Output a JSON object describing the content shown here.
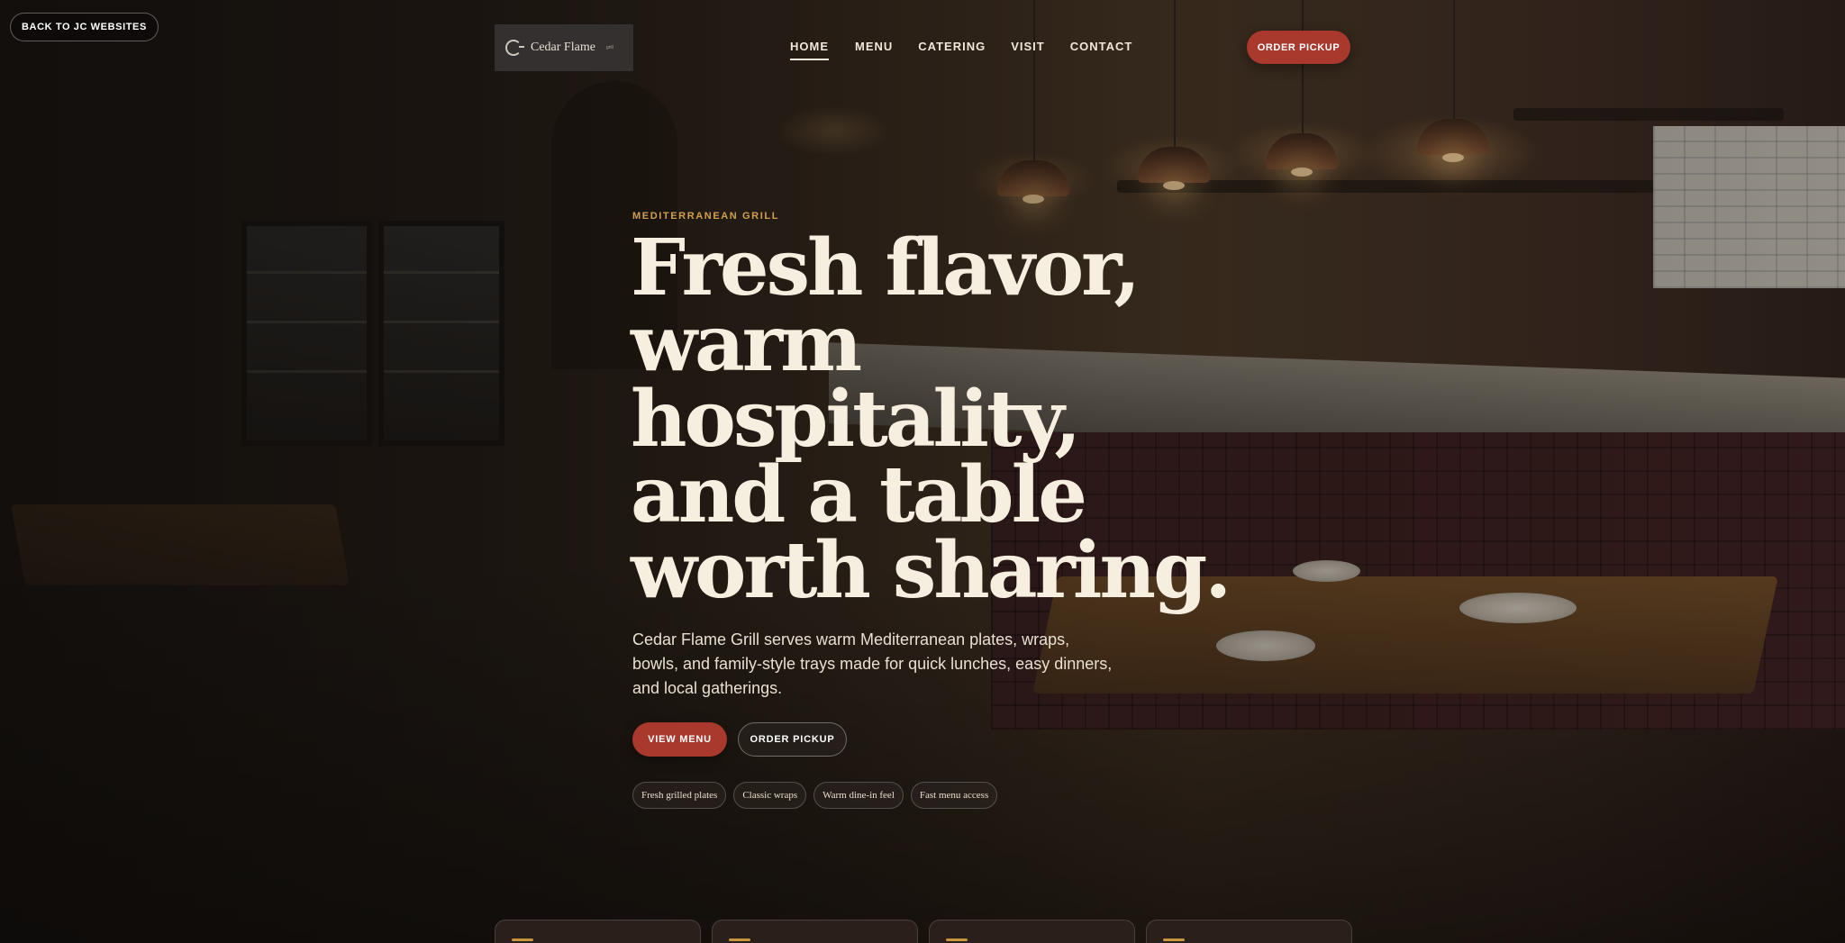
{
  "back_button": {
    "label": "BACK TO JC WEBSITES"
  },
  "logo": {
    "name": "Cedar Flame",
    "sub": "grill",
    "icon": "logo-mark-icon"
  },
  "nav": {
    "items": [
      {
        "label": "HOME",
        "active": true
      },
      {
        "label": "MENU",
        "active": false
      },
      {
        "label": "CATERING",
        "active": false
      },
      {
        "label": "VISIT",
        "active": false
      },
      {
        "label": "CONTACT",
        "active": false
      }
    ],
    "cta_label": "ORDER PICKUP"
  },
  "hero": {
    "eyebrow": "MEDITERRANEAN GRILL",
    "headline_lines": [
      "Fresh flavor,",
      "warm",
      "hospitality,",
      "and a table",
      "worth sharing."
    ],
    "subcopy": "Cedar Flame Grill serves warm Mediterranean plates, wraps, bowls, and family-style trays made for quick lunches, easy dinners, and local gatherings.",
    "primary_cta": "VIEW MENU",
    "secondary_cta": "ORDER PICKUP",
    "tags": [
      "Fresh grilled plates",
      "Classic wraps",
      "Warm dine-in feel",
      "Fast menu access"
    ]
  },
  "colors": {
    "accent_red": "#a8392c",
    "eyebrow_gold": "#d1a04f",
    "headline_cream": "#f6eede"
  }
}
